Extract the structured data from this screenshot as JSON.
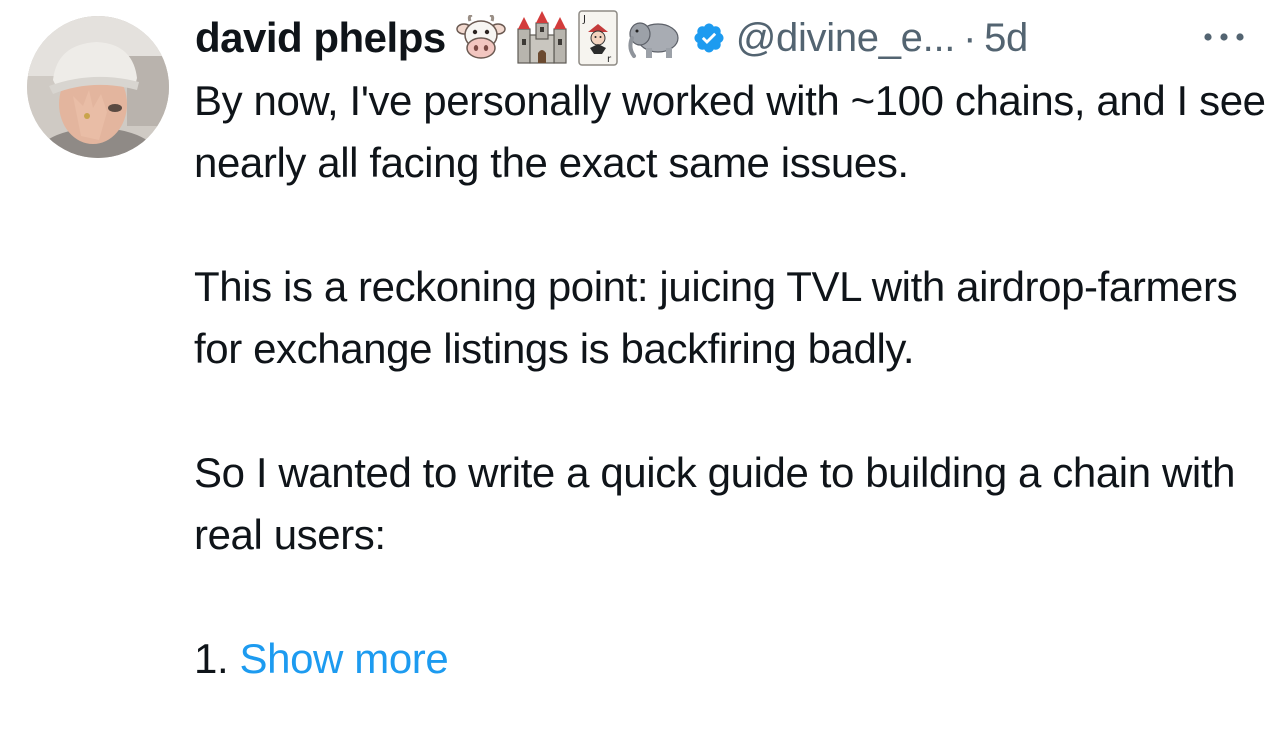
{
  "author": {
    "display_name": "david phelps",
    "handle": "@divine_e...",
    "separator": "·",
    "time": "5d",
    "emojis": [
      {
        "name": "cow-face",
        "char": "🐮"
      },
      {
        "name": "castle",
        "char": "🏰"
      },
      {
        "name": "joker-card",
        "char": "🃏"
      },
      {
        "name": "elephant",
        "char": "🐘"
      }
    ],
    "verified": true,
    "verified_color": "#1d9bf0"
  },
  "tweet": {
    "paragraphs": [
      "By now, I've personally worked with ~100 chains, and I see nearly all facing the exact same issues.",
      "This is a reckoning point: juicing TVL with airdrop-farmers for exchange listings is backfiring badly.",
      "So I wanted to write a quick guide to building a chain with real users:"
    ],
    "truncated_prefix": "1.",
    "show_more_label": "Show more",
    "link_color": "#1d9bf0"
  },
  "more_menu_icon": "ellipsis-icon"
}
